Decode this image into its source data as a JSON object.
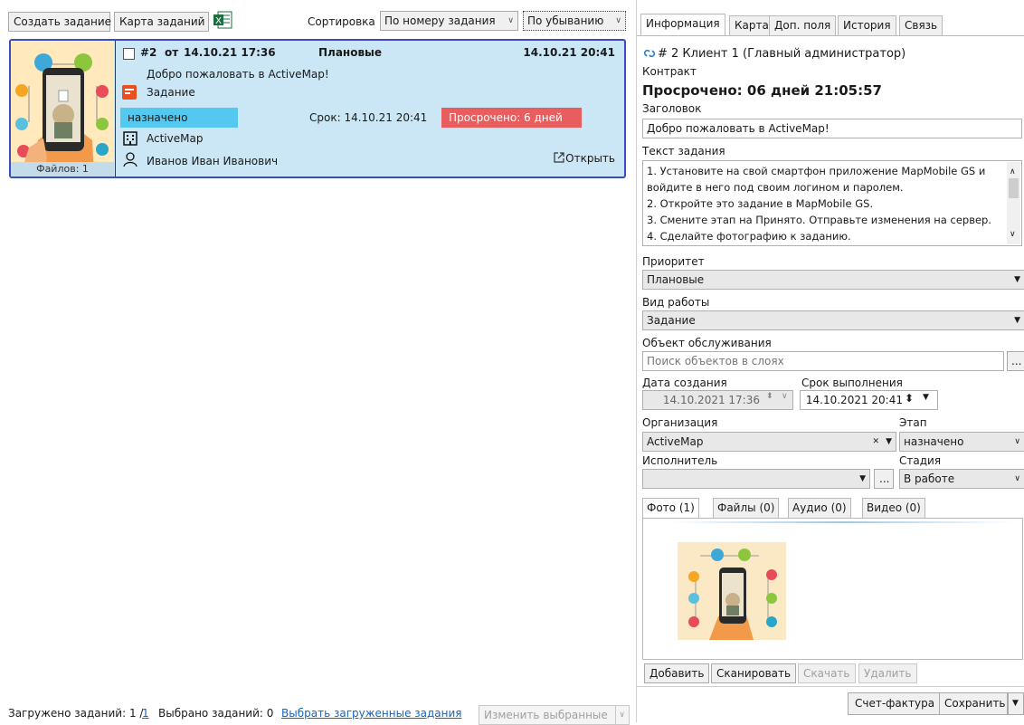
{
  "toolbar": {
    "create_task": "Создать задание",
    "task_map": "Карта заданий",
    "excel_icon_text": "X",
    "sort_label": "Сортировка",
    "sort_by": "По номеру задания",
    "sort_order": "По убыванию"
  },
  "card": {
    "task_number": "#2",
    "from_label": "от",
    "created": "14.10.21 17:36",
    "priority": "Плановые",
    "due_time": "14.10.21 20:41",
    "title": "Добро пожаловать в ActiveMap!",
    "work_type": "Задание",
    "stage": "назначено",
    "deadline": "Срок: 14.10.21 20:41",
    "overdue": "Просрочено: 6 дней",
    "organization": "ActiveMap",
    "executor": "Иванов Иван Иванович",
    "open": "Открыть",
    "files": "Файлов: 1"
  },
  "footer": {
    "loaded_prefix": "Загружено заданий: 1 /",
    "loaded_link": "1",
    "selected": "Выбрано заданий: 0",
    "select_loaded": "Выбрать загруженные задания",
    "change_selected": "Изменить выбранные"
  },
  "panel": {
    "tabs": [
      "Информация",
      "Карта",
      "Доп. поля",
      "История",
      "Связь"
    ],
    "header_line": "# 2  Клиент 1 (Главный администратор)",
    "contract_label": "Контракт",
    "overdue_big": "Просрочено: 06 дней 21:05:57",
    "title_label": "Заголовок",
    "title_value": "Добро пожаловать в ActiveMap!",
    "text_label": "Текст задания",
    "text_lines": [
      "1. Установите на свой смартфон приложение MapMobile GS и",
      "войдите в него под своим логином и паролем.",
      "2. Откройте это задание в MapMobile GS.",
      "3. Смените этап на Принято. Отправьте изменения на сервер.",
      "4. Сделайте фотографию к заданию."
    ],
    "priority_label": "Приоритет",
    "priority_value": "Плановые",
    "worktype_label": "Вид работы",
    "worktype_value": "Задание",
    "object_label": "Объект обслуживания",
    "object_placeholder": "Поиск объектов в слоях",
    "ellipsis": "...",
    "created_label": "Дата создания",
    "created_value": "14.10.2021 17:36",
    "due_label": "Срок выполнения",
    "due_value": "14.10.2021 20:41",
    "org_label": "Организация",
    "org_value": "ActiveMap",
    "stage_label": "Этап",
    "stage_value": "назначено",
    "executor_label": "Исполнитель",
    "executor_value": "",
    "phase_label": "Стадия",
    "phase_value": "В работе",
    "media_tabs": [
      "Фото (1)",
      "Файлы (0)",
      "Аудио (0)",
      "Видео (0)"
    ],
    "add": "Добавить",
    "scan": "Сканировать",
    "download": "Скачать",
    "delete": "Удалить",
    "invoice": "Счет-фактура",
    "save": "Сохранить"
  },
  "colors": {
    "card_bg": "#cbe6f5",
    "card_border": "#3b4cc0",
    "status_assigned": "#55c8f0",
    "status_overdue": "#e85e5e",
    "link": "#1565c0"
  }
}
